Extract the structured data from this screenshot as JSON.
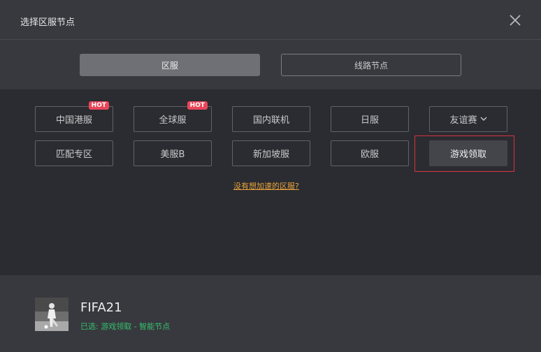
{
  "header": {
    "title": "选择区服节点",
    "close_icon": "close-icon"
  },
  "tabs": [
    {
      "label": "区服",
      "active": true
    },
    {
      "label": "线路节点",
      "active": false
    }
  ],
  "servers": {
    "row1": [
      {
        "label": "中国港服",
        "badge": "HOT"
      },
      {
        "label": "全球服",
        "badge": "HOT"
      },
      {
        "label": "国内联机"
      },
      {
        "label": "日服"
      },
      {
        "label": "友谊赛",
        "icon": "chevron-down-icon"
      }
    ],
    "row2": [
      {
        "label": "匹配专区"
      },
      {
        "label": "美服B"
      },
      {
        "label": "新加坡服"
      },
      {
        "label": "欧服"
      },
      {
        "label": "游戏领取",
        "selected": true
      }
    ]
  },
  "help_link": "没有想加速的区服?",
  "footer": {
    "game_name": "FIFA21",
    "status": "已选: 游戏领取 - 智能节点"
  },
  "colors": {
    "accent_hot": "#e9465a",
    "link": "#e8a23a",
    "status_green": "#34c06e",
    "selected_outline": "#d8323e"
  }
}
